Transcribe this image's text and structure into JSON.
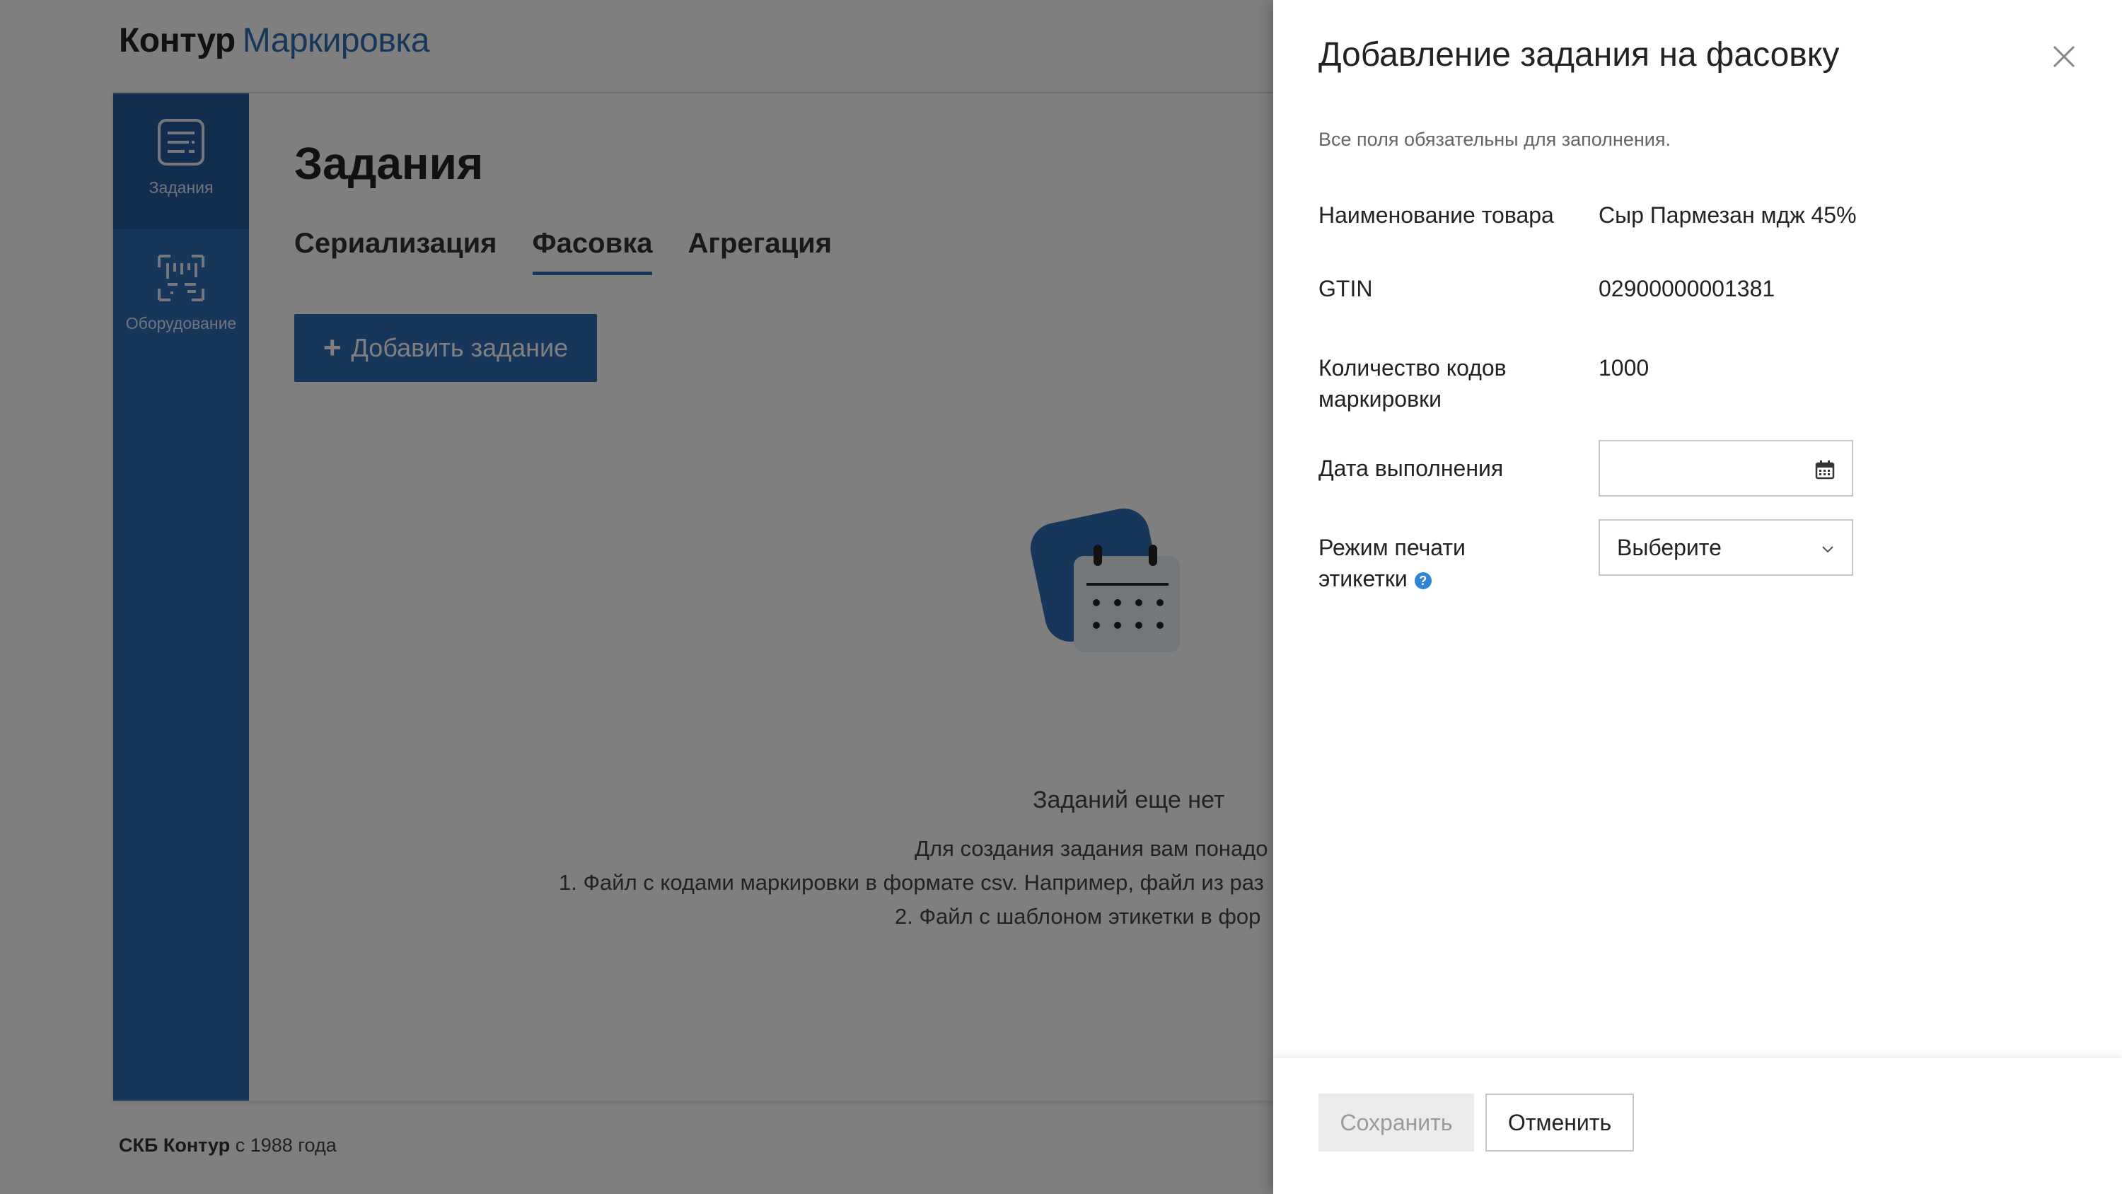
{
  "header": {
    "brand": "Контур",
    "product": "Маркировка"
  },
  "sidebar": {
    "items": [
      {
        "label": "Задания",
        "icon": "tasks-icon",
        "active": true
      },
      {
        "label": "Оборудование",
        "icon": "equipment-icon",
        "active": false
      }
    ]
  },
  "main": {
    "title": "Задания",
    "tabs": [
      {
        "label": "Сериализация",
        "active": false
      },
      {
        "label": "Фасовка",
        "active": true
      },
      {
        "label": "Агрегация",
        "active": false
      }
    ],
    "add_button": "Добавить задание",
    "empty": {
      "title": "Заданий еще нет",
      "lines": [
        "Для создания задания вам понадо",
        "1. Файл с кодами маркировки в формате csv. Например, файл из раз",
        "2. Файл с шаблоном этикетки в фор"
      ]
    }
  },
  "footer": {
    "company": "СКБ Контур",
    "since": "с 1988 года"
  },
  "panel": {
    "title": "Добавление задания на фасовку",
    "note": "Все поля обязательны для заполнения.",
    "fields": {
      "product_name_label": "Наименование товара",
      "product_name_value": "Сыр Пармезан мдж 45%",
      "gtin_label": "GTIN",
      "gtin_value": "02900000001381",
      "codes_count_label_1": "Количество кодов",
      "codes_count_label_2": "маркировки",
      "codes_count_value": "1000",
      "date_label": "Дата выполнения",
      "date_value": "",
      "print_mode_label_1": "Режим печати",
      "print_mode_label_2": "этикетки",
      "print_mode_value": "Выберите"
    },
    "buttons": {
      "save": "Сохранить",
      "cancel": "Отменить"
    }
  },
  "colors": {
    "accent": "#2e6eb5",
    "help": "#2f86d7",
    "overlay": "rgba(0,0,0,0.5)"
  }
}
